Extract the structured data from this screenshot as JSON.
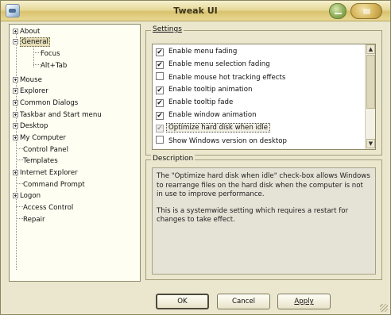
{
  "window": {
    "title": "Tweak UI"
  },
  "tree": {
    "items": [
      {
        "label": "About",
        "expander": "plus",
        "level": 0
      },
      {
        "label": "General",
        "expander": "minus",
        "level": 0,
        "selected": true
      },
      {
        "label": "Focus",
        "expander": "none",
        "level": 1
      },
      {
        "label": "Alt+Tab",
        "expander": "none",
        "level": 1
      },
      {
        "label": "Mouse",
        "expander": "plus",
        "level": 0
      },
      {
        "label": "Explorer",
        "expander": "plus",
        "level": 0
      },
      {
        "label": "Common Dialogs",
        "expander": "plus",
        "level": 0
      },
      {
        "label": "Taskbar and Start menu",
        "expander": "plus",
        "level": 0
      },
      {
        "label": "Desktop",
        "expander": "plus",
        "level": 0
      },
      {
        "label": "My Computer",
        "expander": "plus",
        "level": 0
      },
      {
        "label": "Control Panel",
        "expander": "none",
        "level": 0
      },
      {
        "label": "Templates",
        "expander": "none",
        "level": 0
      },
      {
        "label": "Internet Explorer",
        "expander": "plus",
        "level": 0
      },
      {
        "label": "Command Prompt",
        "expander": "none",
        "level": 0
      },
      {
        "label": "Logon",
        "expander": "plus",
        "level": 0
      },
      {
        "label": "Access Control",
        "expander": "none",
        "level": 0
      },
      {
        "label": "Repair",
        "expander": "none",
        "level": 0
      }
    ]
  },
  "settings": {
    "label": "Settings",
    "items": [
      {
        "label": "Enable menu fading",
        "checked": true
      },
      {
        "label": "Enable menu selection fading",
        "checked": true
      },
      {
        "label": "Enable mouse hot tracking effects",
        "checked": false
      },
      {
        "label": "Enable tooltip animation",
        "checked": true
      },
      {
        "label": "Enable tooltip fade",
        "checked": true
      },
      {
        "label": "Enable window animation",
        "checked": true
      },
      {
        "label": "Optimize hard disk when idle",
        "checked": true,
        "disabled": true,
        "focused": true
      },
      {
        "label": "Show Windows version on desktop",
        "checked": false
      }
    ]
  },
  "description": {
    "label": "Description",
    "paragraphs": [
      "The \"Optimize hard disk when idle\" check-box allows Windows to rearrange files on the hard disk when the computer is not in use to improve performance.",
      "This is a systemwide setting which requires a restart for changes to take effect."
    ]
  },
  "buttons": {
    "ok": "OK",
    "cancel": "Cancel",
    "apply": "Apply"
  },
  "icons": {
    "app": "tweak-ui-icon",
    "expand": "plus-box-icon",
    "collapse": "minus-box-icon",
    "scroll_up": "arrow-up-icon",
    "scroll_down": "arrow-down-icon"
  },
  "colors": {
    "window_bg": "#ebe7cf",
    "title_gradient_mid": "#d9c36e",
    "list_bg": "#ffffff"
  }
}
